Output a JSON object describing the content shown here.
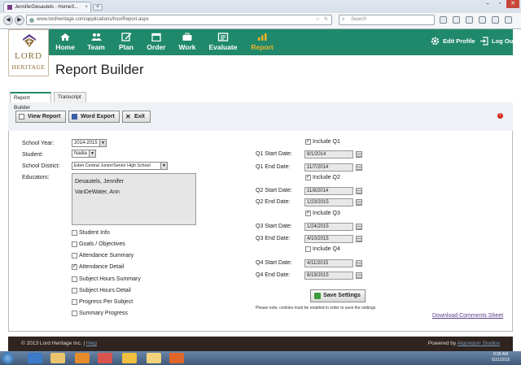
{
  "browser": {
    "tab_title": "JenniferDesautels - HomeS...",
    "url": "www.lordheritage.com/applications/hso/Report.aspx",
    "search_placeholder": "Search",
    "new_tab": "+",
    "tab_close": "×"
  },
  "logo": {
    "line1": "LORD",
    "line2": "HERITAGE"
  },
  "nav": {
    "items": [
      {
        "label": "Home",
        "icon": "home-icon"
      },
      {
        "label": "Team",
        "icon": "team-icon"
      },
      {
        "label": "Plan",
        "icon": "plan-icon"
      },
      {
        "label": "Order",
        "icon": "calendar-icon"
      },
      {
        "label": "Work",
        "icon": "briefcase-icon"
      },
      {
        "label": "Evaluate",
        "icon": "evaluate-icon"
      },
      {
        "label": "Report",
        "icon": "bar-chart-icon",
        "active": true
      }
    ],
    "edit_profile": "Edit Profile",
    "log_out": "Log Out"
  },
  "page_title": "Report Builder",
  "tabs": [
    "Report Builder",
    "Transcript"
  ],
  "toolbar": {
    "view_report": "View Report",
    "word_export": "Word Export",
    "exit": "Exit"
  },
  "form": {
    "school_year_label": "School Year:",
    "school_year_value": "2014-2015",
    "student_label": "Student:",
    "student_value": "Nadia",
    "district_label": "School District:",
    "district_value": "Eden Central Junior/Senior High School",
    "educators_label": "Educators:",
    "educators": [
      "Desautels, Jennifer",
      "VanDeWater, Ann"
    ]
  },
  "sections": [
    {
      "label": "Student Info",
      "checked": false
    },
    {
      "label": "Goals / Objectives",
      "checked": false
    },
    {
      "label": "Attendance Summary",
      "checked": false
    },
    {
      "label": "Attendance Detail",
      "checked": true
    },
    {
      "label": "Subject Hours Summary",
      "checked": false
    },
    {
      "label": "Subject Hours Detail",
      "checked": false
    },
    {
      "label": "Progress Per Subject",
      "checked": false
    },
    {
      "label": "Summary Progress",
      "checked": false
    }
  ],
  "quarters": [
    {
      "include_label": "Include Q1",
      "include": true,
      "start_label": "Q1 Start Date:",
      "start": "8/1/2014",
      "end_label": "Q1 End Date:",
      "end": "11/7/2014"
    },
    {
      "include_label": "Include Q2",
      "include": true,
      "start_label": "Q2 Start Date:",
      "start": "11/8/2014",
      "end_label": "Q2 End Date:",
      "end": "1/23/2015"
    },
    {
      "include_label": "Include Q3",
      "include": true,
      "start_label": "Q3 Start Date:",
      "start": "1/24/2015",
      "end_label": "Q3 End Date:",
      "end": "4/10/2015"
    },
    {
      "include_label": "Include Q4",
      "include": false,
      "start_label": "Q4 Start Date:",
      "start": "4/11/2015",
      "end_label": "Q4 End Date:",
      "end": "6/19/2015"
    }
  ],
  "save_settings": "Save Settings",
  "cookie_note": "Please note, cookies must be enabled in order to save the settings.",
  "download_link": "Download Comments Sheet",
  "footer": {
    "copyright": "© 2013 Lord Heritage Inc.",
    "separator": "|",
    "help": "Help",
    "powered_prefix": "Powered by",
    "powered_by": "Algonquin Studios"
  },
  "taskbar": {
    "time": "9:39 AM",
    "date": "5/31/2015"
  },
  "colors": {
    "brand_green": "#20896b",
    "active_nav": "#f0b429",
    "footer_bg": "#2f241f"
  }
}
